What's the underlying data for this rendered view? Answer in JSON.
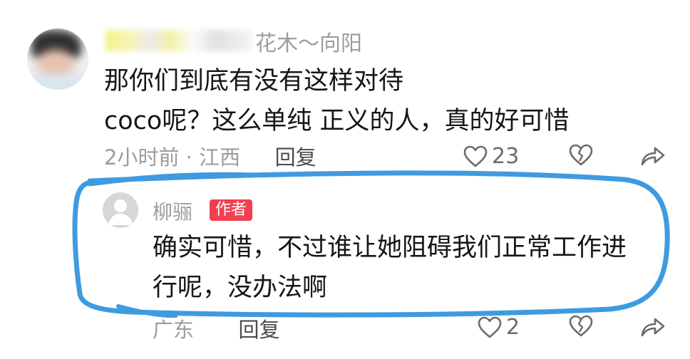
{
  "comment": {
    "username_suffix": "花木～向阳",
    "lines": [
      "那你们到底有没有这样对待",
      "coco呢？这么单纯 正义的人，真的好可惜"
    ],
    "time": "2小时前",
    "dot": "·",
    "location": "江西",
    "reply_label": "回复",
    "like_count": "23",
    "icons": {
      "like": "heart-icon",
      "dislike": "broken-heart-icon",
      "share": "share-arrow-icon"
    }
  },
  "reply": {
    "username": "柳骊",
    "badge": "作者",
    "lines": [
      "确实可惜，不过谁让她阻碍我们正常工作进",
      "行呢，没办法啊"
    ],
    "location": "广东",
    "reply_label": "回复",
    "like_count": "2",
    "icons": {
      "avatar": "default-avatar-icon",
      "like": "heart-icon",
      "dislike": "broken-heart-icon",
      "share": "share-arrow-icon"
    }
  },
  "colors": {
    "badge": "#f0404f",
    "highlight_stroke": "#3f9bdf",
    "muted_text": "#9c9c9c",
    "body_text": "#161616"
  }
}
